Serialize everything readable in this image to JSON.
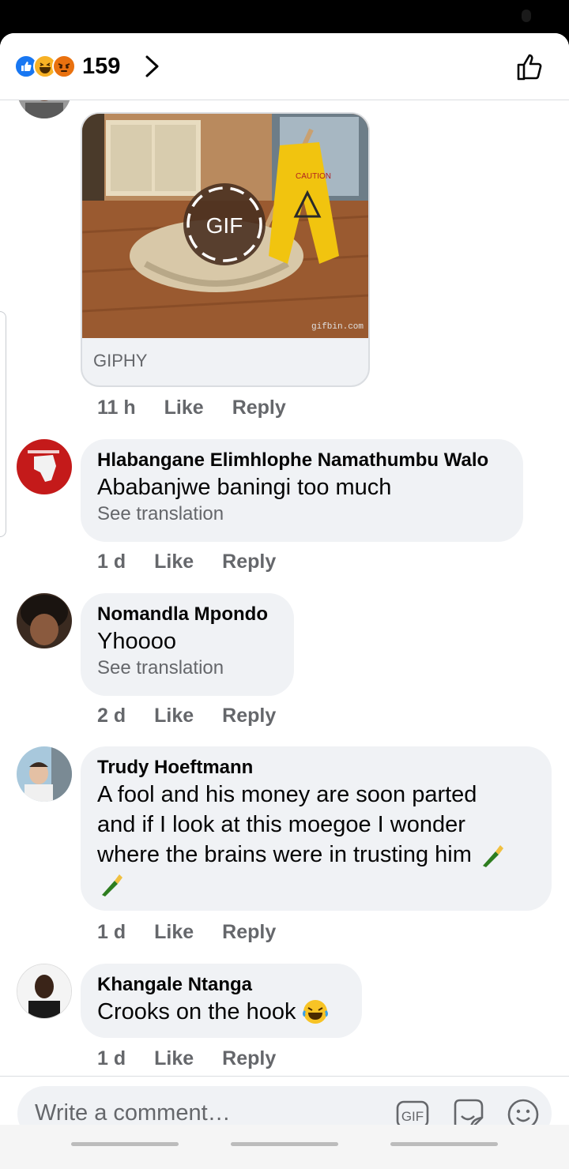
{
  "header": {
    "reaction_count": "159",
    "reaction_icons": [
      "like-reaction",
      "haha-reaction",
      "angry-reaction"
    ]
  },
  "gif_comment": {
    "badge": "GIF",
    "watermark": "gifbin.com",
    "sign_text": "CAUTION",
    "source": "GIPHY",
    "time": "11 h",
    "like": "Like",
    "reply": "Reply"
  },
  "comments": [
    {
      "author": "Hlabangane Elimhlophe Namathumbu Walo",
      "text": "Ababanjwe baningi too much",
      "translation": "See translation",
      "time": "1 d",
      "like": "Like",
      "reply": "Reply"
    },
    {
      "author": "Nomandla Mpondo",
      "text": "Yhoooo",
      "translation": "See translation",
      "time": "2 d",
      "like": "Like",
      "reply": "Reply"
    },
    {
      "author": "Trudy Hoeftmann",
      "text_lines": [
        "A fool and his money are soon parted",
        "and if I look at this moegoe I wonder",
        "where the brains were in trusting him"
      ],
      "time": "1 d",
      "like": "Like",
      "reply": "Reply"
    },
    {
      "author": "Khangale Ntanga",
      "text": "Crooks on the hook",
      "time": "1 d",
      "like": "Like",
      "reply": "Reply"
    }
  ],
  "composer": {
    "placeholder": "Write a comment…",
    "gif_label": "GIF"
  },
  "colors": {
    "brand_blue": "#1877f2",
    "bubble_bg": "#f0f2f5",
    "secondary_text": "#65676b"
  }
}
